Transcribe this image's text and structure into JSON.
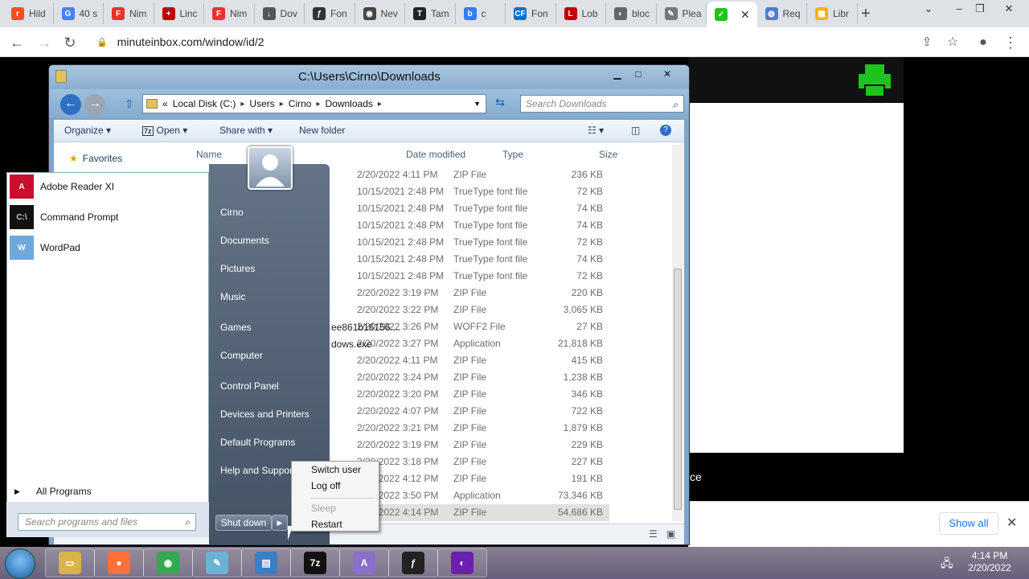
{
  "browser": {
    "tabs": [
      {
        "label": "Hild",
        "color": "#f4511e",
        "glyph": "r"
      },
      {
        "label": "40 s",
        "color": "#4285f4",
        "glyph": "G"
      },
      {
        "label": "Nim",
        "color": "#e8322b",
        "glyph": "F"
      },
      {
        "label": "Linc",
        "color": "#c00000",
        "glyph": "+"
      },
      {
        "label": "Nim",
        "color": "#e8322b",
        "glyph": "F"
      },
      {
        "label": "Dov",
        "color": "#555555",
        "glyph": "↓"
      },
      {
        "label": "Fon",
        "color": "#333333",
        "glyph": "ƒ"
      },
      {
        "label": "Nev",
        "color": "#444444",
        "glyph": "◉"
      },
      {
        "label": "Tam",
        "color": "#222222",
        "glyph": "T"
      },
      {
        "label": "c",
        "color": "#2d7ff9",
        "glyph": "b"
      },
      {
        "label": "Fon",
        "color": "#0072ce",
        "glyph": "CF"
      },
      {
        "label": "Lob",
        "color": "#c00000",
        "glyph": "L"
      },
      {
        "label": "bloc",
        "color": "#666666",
        "glyph": "◐"
      },
      {
        "label": "Plea",
        "color": "#777777",
        "glyph": "✎"
      },
      {
        "label": "",
        "color": "#1ec31e",
        "glyph": "✓"
      },
      {
        "label": "Req",
        "color": "#4a7dd1",
        "glyph": "◍"
      },
      {
        "label": "Libr",
        "color": "#f4b400",
        "glyph": "▦"
      }
    ],
    "url": "minuteinbox.com/window/id/2"
  },
  "web": {
    "trailing_text": "ce",
    "show_all_label": "Show all"
  },
  "explorer": {
    "title": "C:\\Users\\Cirno\\Downloads",
    "breadcrumb": [
      "«",
      "Local Disk (C:)",
      "Users",
      "Cirno",
      "Downloads"
    ],
    "search_placeholder": "Search Downloads",
    "commands": {
      "organize": "Organize ▾",
      "open": "Open ▾",
      "share": "Share with ▾",
      "new_folder": "New folder"
    },
    "open_badge": "7z",
    "columns": {
      "name": "Name",
      "date": "Date modified",
      "type": "Type",
      "size": "Size"
    },
    "favorites": "Favorites",
    "partial_names": [
      "ee861b16156....",
      "dows.exe"
    ],
    "files": [
      {
        "date": "2/20/2022 4:11 PM",
        "type": "ZIP File",
        "size": "236 KB"
      },
      {
        "date": "10/15/2021 2:48 PM",
        "type": "TrueType font file",
        "size": "72 KB"
      },
      {
        "date": "10/15/2021 2:48 PM",
        "type": "TrueType font file",
        "size": "74 KB"
      },
      {
        "date": "10/15/2021 2:48 PM",
        "type": "TrueType font file",
        "size": "74 KB"
      },
      {
        "date": "10/15/2021 2:48 PM",
        "type": "TrueType font file",
        "size": "72 KB"
      },
      {
        "date": "10/15/2021 2:48 PM",
        "type": "TrueType font file",
        "size": "74 KB"
      },
      {
        "date": "10/15/2021 2:48 PM",
        "type": "TrueType font file",
        "size": "72 KB"
      },
      {
        "date": "2/20/2022 3:19 PM",
        "type": "ZIP File",
        "size": "220 KB"
      },
      {
        "date": "2/20/2022 3:22 PM",
        "type": "ZIP File",
        "size": "3,065 KB"
      },
      {
        "date": "2/20/2022 3:26 PM",
        "type": "WOFF2 File",
        "size": "27 KB"
      },
      {
        "date": "2/20/2022 3:27 PM",
        "type": "Application",
        "size": "21,818 KB"
      },
      {
        "date": "2/20/2022 4:11 PM",
        "type": "ZIP File",
        "size": "415 KB"
      },
      {
        "date": "2/20/2022 3:24 PM",
        "type": "ZIP File",
        "size": "1,238 KB"
      },
      {
        "date": "2/20/2022 3:20 PM",
        "type": "ZIP File",
        "size": "346 KB"
      },
      {
        "date": "2/20/2022 4:07 PM",
        "type": "ZIP File",
        "size": "722 KB"
      },
      {
        "date": "2/20/2022 3:21 PM",
        "type": "ZIP File",
        "size": "1,879 KB"
      },
      {
        "date": "2/20/2022 3:19 PM",
        "type": "ZIP File",
        "size": "229 KB"
      },
      {
        "date": "2/20/2022 3:18 PM",
        "type": "ZIP File",
        "size": "227 KB"
      },
      {
        "date": "2/20/2022 4:12 PM",
        "type": "ZIP File",
        "size": "191 KB"
      },
      {
        "date": "2/20/2022 3:50 PM",
        "type": "Application",
        "size": "73,346 KB"
      },
      {
        "date": "2/20/2022 4:14 PM",
        "type": "ZIP File",
        "size": "54,686 KB"
      }
    ]
  },
  "start_menu": {
    "programs": [
      {
        "label": "Adobe Reader XI",
        "icon": "adobe-reader-icon"
      },
      {
        "label": "Command Prompt",
        "icon": "command-prompt-icon"
      },
      {
        "label": "WordPad",
        "icon": "wordpad-icon"
      }
    ],
    "all_programs": "All Programs",
    "search_placeholder": "Search programs and files",
    "places": [
      "Cirno",
      "Documents",
      "Pictures",
      "Music",
      "Games",
      "Computer",
      "Control Panel",
      "Devices and Printers",
      "Default Programs",
      "Help and Support"
    ],
    "shutdown": "Shut down",
    "power_menu": {
      "switch_user": "Switch user",
      "log_off": "Log off",
      "sleep": "Sleep",
      "restart": "Restart"
    }
  },
  "taskbar": {
    "time": "4:14 PM",
    "date": "2/20/2022",
    "apps": [
      {
        "name": "explorer",
        "color": "#d9b44a",
        "glyph": "▭"
      },
      {
        "name": "firefox",
        "color": "#ff7139",
        "glyph": "●"
      },
      {
        "name": "chrome",
        "color": "#34a853",
        "glyph": "◉"
      },
      {
        "name": "notepad",
        "color": "#6cb1d6",
        "glyph": "✎"
      },
      {
        "name": "control-panel",
        "color": "#3c7ec4",
        "glyph": "▤"
      },
      {
        "name": "7-zip",
        "color": "#111111",
        "glyph": "7z"
      },
      {
        "name": "fontforge",
        "color": "#8a6fc9",
        "glyph": "A"
      },
      {
        "name": "font-app",
        "color": "#222222",
        "glyph": "ƒ"
      },
      {
        "name": "media-app",
        "color": "#6a1fb0",
        "glyph": "◐"
      }
    ]
  },
  "colors": {
    "accent": "#1a73e8",
    "printer": "#1ec31e",
    "start_orb": "#1d5fa4"
  }
}
